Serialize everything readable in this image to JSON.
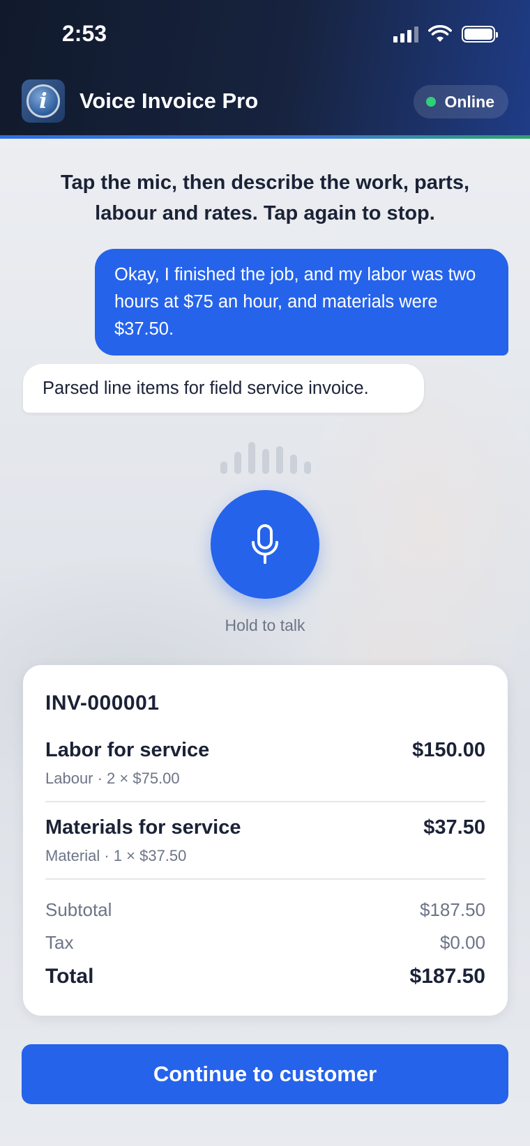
{
  "status_bar": {
    "time": "2:53"
  },
  "header": {
    "app_title": "Voice Invoice Pro",
    "status": "Online"
  },
  "instruction": "Tap the mic, then describe the work, parts, labour and rates. Tap again to stop.",
  "chat": {
    "user_message": "Okay, I finished the job, and my labor was two hours at $75 an hour, and materials were $37.50.",
    "bot_message": "Parsed line items for field service invoice."
  },
  "mic": {
    "label": "Hold to talk"
  },
  "invoice": {
    "number": "INV-000001",
    "items": [
      {
        "name": "Labor for service",
        "meta": "Labour · 2 × $75.00",
        "amount": "$150.00"
      },
      {
        "name": "Materials for service",
        "meta": "Material · 1 × $37.50",
        "amount": "$37.50"
      }
    ],
    "subtotal_label": "Subtotal",
    "subtotal": "$187.50",
    "tax_label": "Tax",
    "tax": "$0.00",
    "total_label": "Total",
    "total": "$187.50"
  },
  "cta": {
    "label": "Continue to customer"
  },
  "colors": {
    "primary": "#2563eb",
    "online": "#2fd07a",
    "header_dark": "#111a2c"
  }
}
